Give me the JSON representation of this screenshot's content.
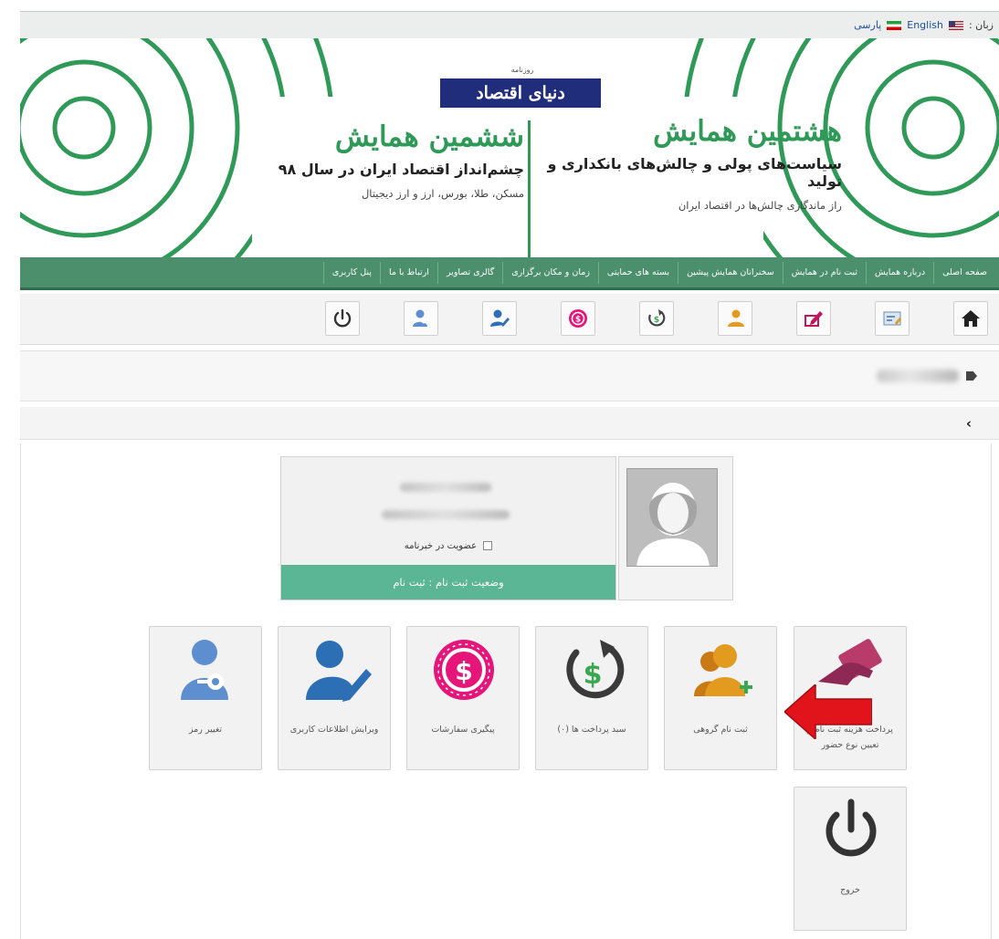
{
  "language_bar": {
    "label": "زبان :",
    "options": [
      "English",
      "پارسی"
    ]
  },
  "banner": {
    "logo_top": "روزنامه",
    "logo_text": "دنیای اقتصاد",
    "right_conference": {
      "title": "هشتمین همایش",
      "subtitle": "سیاست‌های پولی و چالش‌های بانکداری و تولید",
      "desc": "راز ماندگاری چالش‌ها در اقتصاد ایران"
    },
    "left_conference": {
      "title": "ششمین همایش",
      "subtitle": "چشم‌انداز اقتصاد ایران در سال ۹۸",
      "desc": "مسکن، طلا، بورس، ارز و ارز دیجیتال"
    },
    "accent_color": "#2f9a57"
  },
  "main_nav": {
    "items": [
      "صفحه اصلی",
      "درباره همایش",
      "ثبت نام در همایش",
      "سخنرانان همایش پیشین",
      "بسته های حمایتی",
      "زمان و مکان برگزاری",
      "گالری تصاویر",
      "ارتباط با ما",
      "پنل کاربری"
    ]
  },
  "icon_toolbar": {
    "icons": [
      "home-icon",
      "registration-form-icon",
      "edit-icon",
      "group-user-icon",
      "payment-cycle-icon",
      "orders-icon",
      "user-edit-icon",
      "user-key-icon",
      "power-icon"
    ]
  },
  "profile": {
    "newsletter_label": "عضویت در خبرنامه",
    "status_text": "وضعیت ثبت نام : ثبت نام"
  },
  "tiles": [
    {
      "name": "pay-fee-tile",
      "label_line1": "پرداخت هزینه ثبت نام و",
      "label_line2": "تعیین نوع حضور",
      "icon": "hand-card-icon"
    },
    {
      "name": "group-registration-tile",
      "label_line1": "ثبت نام گروهی",
      "label_line2": "",
      "icon": "group-user-add-icon"
    },
    {
      "name": "payment-basket-tile",
      "label_line1": "سبد پرداخت ها (۰)",
      "label_line2": "",
      "icon": "dollar-cycle-icon"
    },
    {
      "name": "order-tracking-tile",
      "label_line1": "پیگیری سفارشات",
      "label_line2": "",
      "icon": "dollar-coin-icon"
    },
    {
      "name": "edit-user-info-tile",
      "label_line1": "ویرایش اطلاعات کاربری",
      "label_line2": "",
      "icon": "user-pencil-icon"
    },
    {
      "name": "change-password-tile",
      "label_line1": "تغییر رمز",
      "label_line2": "",
      "icon": "user-key-icon"
    },
    {
      "name": "logout-tile",
      "label_line1": "خروج",
      "label_line2": "",
      "icon": "power-icon"
    }
  ],
  "colors": {
    "nav_green": "#4c8f6d",
    "status_green": "#5ab694",
    "arrow_red": "#e1141b",
    "pink": "#e5157a",
    "blue": "#2d6fb5",
    "orange": "#e39b1f"
  }
}
